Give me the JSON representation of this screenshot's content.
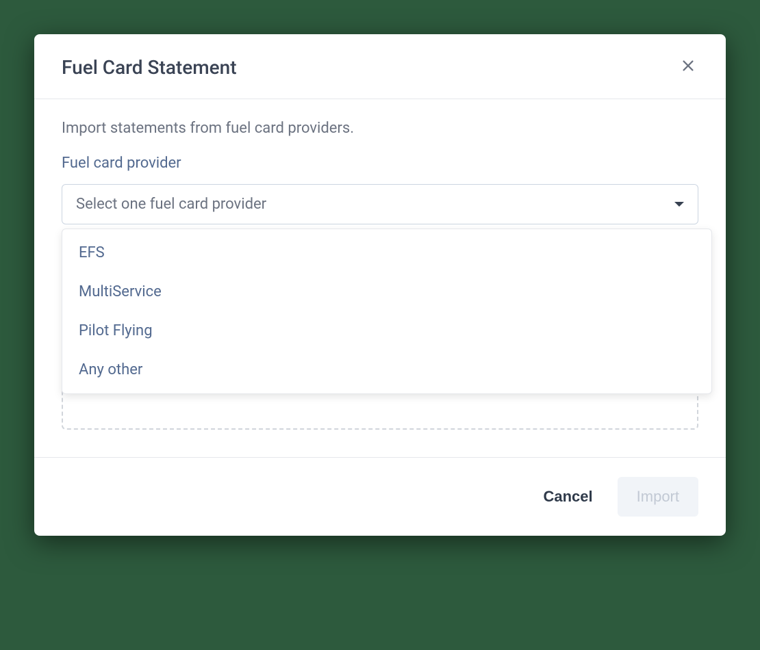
{
  "modal": {
    "title": "Fuel Card Statement",
    "description": "Import statements from fuel card providers.",
    "field_label": "Fuel card provider",
    "select_placeholder": "Select one fuel card provider",
    "options": [
      {
        "label": "EFS"
      },
      {
        "label": "MultiService"
      },
      {
        "label": "Pilot Flying"
      },
      {
        "label": "Any other"
      }
    ],
    "footer": {
      "cancel_label": "Cancel",
      "import_label": "Import"
    }
  }
}
